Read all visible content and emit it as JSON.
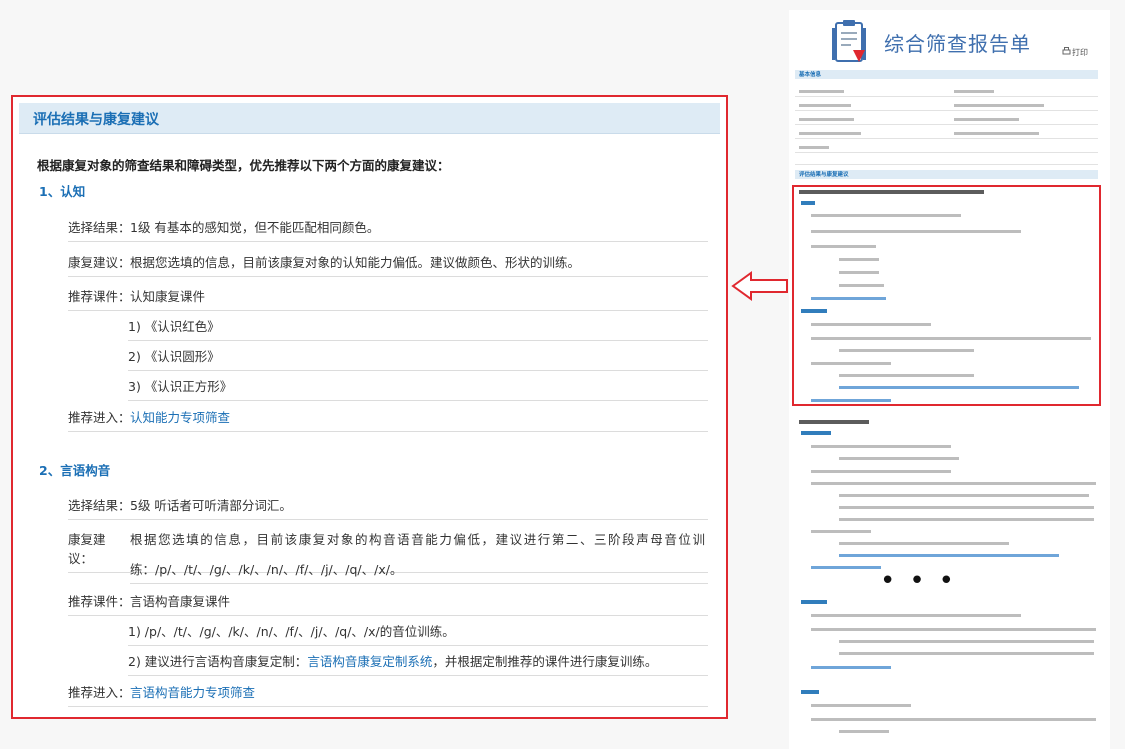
{
  "panel": {
    "header": "评估结果与康复建议",
    "intro": "根据康复对象的筛查结果和障碍类型，优先推荐以下两个方面的康复建议：",
    "sections": [
      {
        "title": "1、认知",
        "result_label": "选择结果：",
        "result": "1级 有基本的感知觉，但不能匹配相同颜色。",
        "advice_label": "康复建议：",
        "advice": "根据您选填的信息，目前该康复对象的认知能力偏低。建议做颜色、形状的训练。",
        "course_label": "推荐课件：",
        "course": "认知康复课件",
        "course_items": [
          "1) 《认识红色》",
          "2) 《认识圆形》",
          "3) 《认识正方形》"
        ],
        "entry_label": "推荐进入：",
        "entry": "认知能力专项筛查"
      },
      {
        "title": "2、言语构音",
        "result_label": "选择结果：",
        "result": "5级 听话者可听清部分词汇。",
        "advice_label": "康复建议：",
        "advice": "根据您选填的信息，目前该康复对象的构音语音能力偏低，建议进行第二、三阶段声母音位训",
        "advice_cont": "练：/p/、/t/、/g/、/k/、/n/、/f/、/j/、/q/、/x/。",
        "course_label": "推荐课件：",
        "course": "言语构音康复课件",
        "course_items": [
          "1) /p/、/t/、/g/、/k/、/n/、/f/、/j/、/q/、/x/的音位训练。"
        ],
        "course_item2_pre": "2) 建议进行言语构音康复定制：",
        "course_item2_link": "言语构音康复定制系统",
        "course_item2_post": "，并根据定制推荐的课件进行康复训练。",
        "entry_label": "推荐进入：",
        "entry": "言语构音能力专项筛查"
      }
    ]
  },
  "report": {
    "title": "综合筛查报告单",
    "print": "打印",
    "bar1": "基本信息",
    "bar2": "评估结果与康复建议"
  },
  "colors": {
    "accent": "#1b6fb5",
    "highlight_border": "#e0282f",
    "header_bg": "#deebf5"
  },
  "icons": [
    "clipboard-icon",
    "printer-icon",
    "left-arrow-icon"
  ]
}
